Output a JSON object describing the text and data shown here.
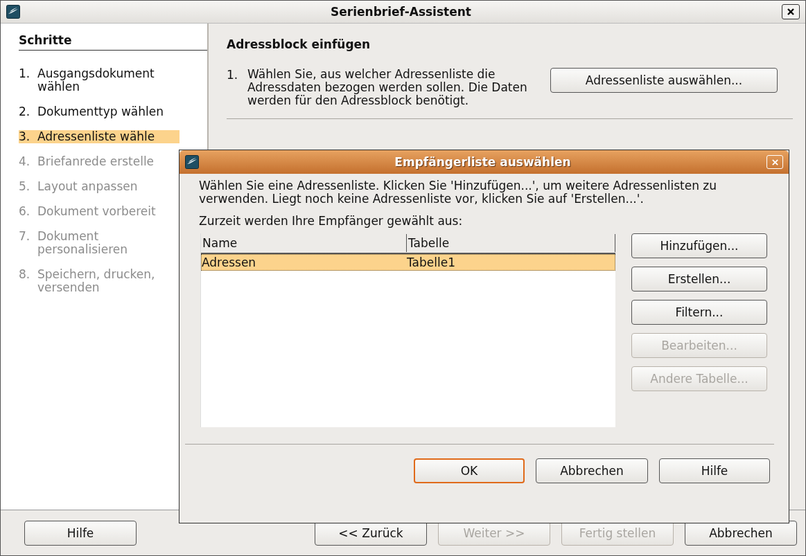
{
  "window": {
    "title": "Serienbrief-Assistent"
  },
  "sidebar": {
    "heading": "Schritte",
    "steps": [
      {
        "number": "1.",
        "label": "Ausgangsdokument wählen",
        "selected": false,
        "disabled": false
      },
      {
        "number": "2.",
        "label": "Dokumenttyp wählen",
        "selected": false,
        "disabled": false
      },
      {
        "number": "3.",
        "label": "Adressenliste wähle",
        "selected": true,
        "disabled": false
      },
      {
        "number": "4.",
        "label": "Briefanrede erstelle",
        "selected": false,
        "disabled": true
      },
      {
        "number": "5.",
        "label": "Layout anpassen",
        "selected": false,
        "disabled": true
      },
      {
        "number": "6.",
        "label": "Dokument vorbereit",
        "selected": false,
        "disabled": true
      },
      {
        "number": "7.",
        "label": "Dokument personalisieren",
        "selected": false,
        "disabled": true
      },
      {
        "number": "8.",
        "label": "Speichern, drucken, versenden",
        "selected": false,
        "disabled": true
      }
    ]
  },
  "content": {
    "heading": "Adressblock einfügen",
    "steps": [
      {
        "number": "1.",
        "text": "Wählen Sie, aus welcher Adressenliste die Adressdaten bezogen werden sollen. Die Daten werden für den Adressblock benötigt.",
        "button": "Adressenliste auswählen..."
      }
    ]
  },
  "footer": {
    "buttons": [
      {
        "label": "Hilfe",
        "disabled": false
      },
      {
        "label": "<< Zurück",
        "disabled": false
      },
      {
        "label": "Weiter >>",
        "disabled": true
      },
      {
        "label": "Fertig stellen",
        "disabled": true
      },
      {
        "label": "Abbrechen",
        "disabled": false
      }
    ]
  },
  "dialog": {
    "title": "Empfängerliste auswählen",
    "description": "Wählen Sie eine Adressenliste. Klicken Sie 'Hinzufügen...', um weitere Adressenlisten zu verwenden. Liegt noch keine Adressenliste vor, klicken Sie auf 'Erstellen...'.",
    "source_label": "Zurzeit werden Ihre Empfänger gewählt aus:",
    "table": {
      "columns": [
        "Name",
        "Tabelle"
      ],
      "rows": [
        {
          "cells": [
            "Adressen",
            "Tabelle1"
          ],
          "selected": true
        }
      ]
    },
    "side_buttons": [
      {
        "label": "Hinzufügen...",
        "disabled": false
      },
      {
        "label": "Erstellen...",
        "disabled": false
      },
      {
        "label": "Filtern...",
        "disabled": false
      },
      {
        "label": "Bearbeiten...",
        "disabled": true
      },
      {
        "label": "Andere Tabelle...",
        "disabled": true
      }
    ],
    "buttons": [
      {
        "label": "OK",
        "default": true
      },
      {
        "label": "Abbrechen",
        "default": false
      },
      {
        "label": "Hilfe",
        "default": false
      }
    ]
  }
}
